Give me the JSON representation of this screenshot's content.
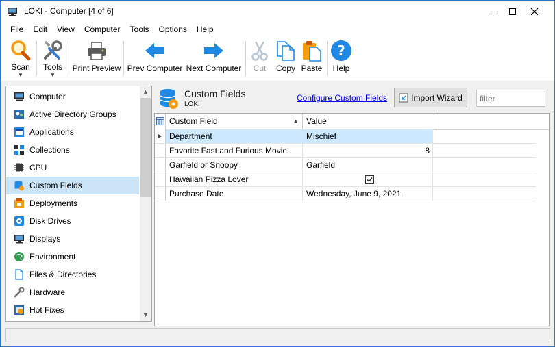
{
  "window": {
    "title": "LOKI - Computer [4 of 6]"
  },
  "menu": [
    "File",
    "Edit",
    "View",
    "Computer",
    "Tools",
    "Options",
    "Help"
  ],
  "toolbar": {
    "scan": "Scan",
    "tools": "Tools",
    "print_preview": "Print Preview",
    "prev_computer": "Prev Computer",
    "next_computer": "Next Computer",
    "cut": "Cut",
    "copy": "Copy",
    "paste": "Paste",
    "help": "Help"
  },
  "nav": {
    "items": [
      {
        "label": "Computer",
        "icon": "computer-icon"
      },
      {
        "label": "Active Directory Groups",
        "icon": "ad-groups-icon"
      },
      {
        "label": "Applications",
        "icon": "applications-icon"
      },
      {
        "label": "Collections",
        "icon": "collections-icon"
      },
      {
        "label": "CPU",
        "icon": "cpu-icon"
      },
      {
        "label": "Custom Fields",
        "icon": "custom-fields-icon",
        "selected": true
      },
      {
        "label": "Deployments",
        "icon": "deployments-icon"
      },
      {
        "label": "Disk Drives",
        "icon": "disk-drives-icon"
      },
      {
        "label": "Displays",
        "icon": "displays-icon"
      },
      {
        "label": "Environment",
        "icon": "environment-icon"
      },
      {
        "label": "Files & Directories",
        "icon": "files-icon"
      },
      {
        "label": "Hardware",
        "icon": "hardware-icon"
      },
      {
        "label": "Hot Fixes",
        "icon": "hotfixes-icon"
      }
    ]
  },
  "panel": {
    "title": "Custom Fields",
    "subtitle": "LOKI",
    "configure_link": "Configure Custom Fields",
    "import_button": "Import Wizard",
    "filter_placeholder": "filter"
  },
  "grid": {
    "columns": [
      "Custom Field",
      "Value"
    ],
    "rows": [
      {
        "field": "Department",
        "value": "Mischief",
        "type": "text",
        "selected": true
      },
      {
        "field": "Favorite Fast and Furious Movie",
        "value": "8",
        "type": "number"
      },
      {
        "field": "Garfield or Snoopy",
        "value": "Garfield",
        "type": "text"
      },
      {
        "field": "Hawaiian Pizza Lover",
        "value": "true",
        "type": "checkbox"
      },
      {
        "field": "Purchase Date",
        "value": "Wednesday, June 9, 2021",
        "type": "text"
      }
    ]
  },
  "colors": {
    "accent_blue": "#1e88e5",
    "selection": "#cce8ff",
    "nav_selection": "#cce4f7",
    "link": "#0000ee"
  }
}
